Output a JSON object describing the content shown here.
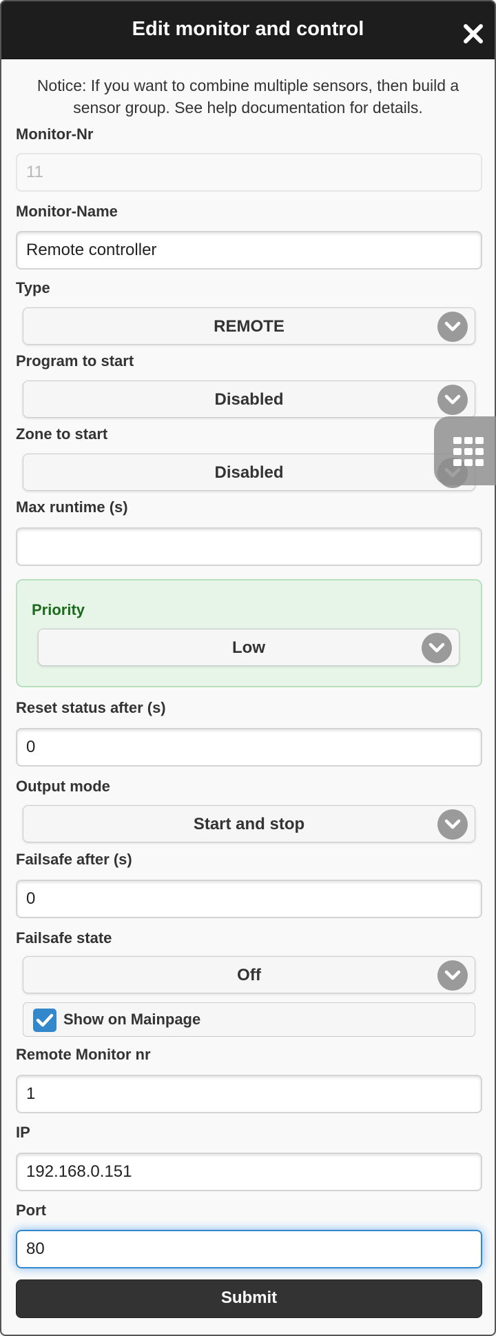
{
  "dialog": {
    "title": "Edit monitor and control",
    "notice": "Notice: If you want to combine multiple sensors, then build a sensor group. See help documentation for details."
  },
  "fields": {
    "monitor_nr": {
      "label": "Monitor-Nr",
      "value": "11"
    },
    "monitor_name": {
      "label": "Monitor-Name",
      "value": "Remote controller"
    },
    "type": {
      "label": "Type",
      "value": "REMOTE"
    },
    "program_to_start": {
      "label": "Program to start",
      "value": "Disabled"
    },
    "zone_to_start": {
      "label": "Zone to start",
      "value": "Disabled"
    },
    "max_runtime": {
      "label": "Max runtime (s)",
      "value": ""
    },
    "priority": {
      "label": "Priority",
      "value": "Low"
    },
    "reset_status": {
      "label": "Reset status after (s)",
      "value": "0"
    },
    "output_mode": {
      "label": "Output mode",
      "value": "Start and stop"
    },
    "failsafe_after": {
      "label": "Failsafe after (s)",
      "value": "0"
    },
    "failsafe_state": {
      "label": "Failsafe state",
      "value": "Off"
    },
    "show_on_mainpage": {
      "label": "Show on Mainpage",
      "checked": true
    },
    "remote_monitor_nr": {
      "label": "Remote Monitor nr",
      "value": "1"
    },
    "ip": {
      "label": "IP",
      "value": "192.168.0.151"
    },
    "port": {
      "label": "Port",
      "value": "80"
    }
  },
  "actions": {
    "submit_label": "Submit"
  },
  "colors": {
    "header_bg": "#1d1d1d",
    "priority_bg": "#e6f5e7",
    "priority_text": "#1c6a1c",
    "checkbox_accent": "#3388cc",
    "focus_glow": "#7fb8f2"
  },
  "icons": {
    "close": "close-icon",
    "chevron": "chevron-down-icon",
    "check": "check-icon",
    "grid": "grid-icon"
  }
}
